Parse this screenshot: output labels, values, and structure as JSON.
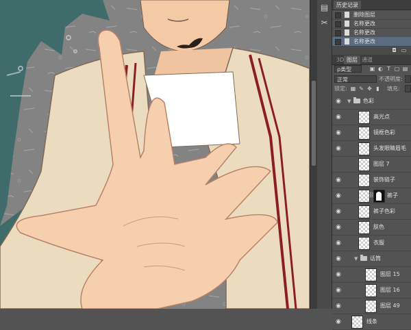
{
  "history_panel": {
    "tab_label": "历史记录",
    "items": [
      {
        "label": "删除图层",
        "selected": false
      },
      {
        "label": "名称更改",
        "selected": false
      },
      {
        "label": "名称更改",
        "selected": false
      },
      {
        "label": "名称更改",
        "selected": true
      }
    ]
  },
  "layers_panel": {
    "tabs": [
      "3D",
      "图层",
      "通道"
    ],
    "active_tab": "图层",
    "filter_kind": "ρ类型",
    "blend_mode": "正常",
    "opacity_label": "不透明度:",
    "lock_label": "锁定:",
    "fill_label": "填充:",
    "layers": [
      {
        "name": "色彩",
        "type": "group",
        "indent": 0,
        "visible": true,
        "expanded": true
      },
      {
        "name": "高光点",
        "type": "layer",
        "indent": 1,
        "visible": true
      },
      {
        "name": "镜框色彩",
        "type": "layer",
        "indent": 1,
        "visible": true
      },
      {
        "name": "头发眼睛眉毛",
        "type": "layer",
        "indent": 1,
        "visible": true
      },
      {
        "name": "图层 7",
        "type": "layer",
        "indent": 1,
        "visible": false
      },
      {
        "name": "装饰链子",
        "type": "layer",
        "indent": 1,
        "visible": true
      },
      {
        "name": "裤子",
        "type": "layer",
        "indent": 1,
        "visible": true,
        "has_mask": true
      },
      {
        "name": "裤子色彩",
        "type": "layer",
        "indent": 1,
        "visible": true
      },
      {
        "name": "肤色",
        "type": "layer",
        "indent": 1,
        "visible": true
      },
      {
        "name": "衣服",
        "type": "layer",
        "indent": 1,
        "visible": true
      },
      {
        "name": "话筒",
        "type": "group",
        "indent": 1,
        "visible": true,
        "expanded": true
      },
      {
        "name": "图层 15",
        "type": "layer",
        "indent": 2,
        "visible": true
      },
      {
        "name": "图层 16",
        "type": "layer",
        "indent": 2,
        "visible": true
      },
      {
        "name": "图层 49",
        "type": "layer",
        "indent": 2,
        "visible": true
      },
      {
        "name": "线条",
        "type": "layer",
        "indent": 0,
        "visible": true
      }
    ]
  },
  "icons": {
    "history_doc": "document-icon",
    "history_tool": "history-brush-icon",
    "eye": "eye-icon",
    "folder": "folder-icon",
    "chain": "link-icon"
  },
  "colors": {
    "panel_bg": "#535353",
    "selected_row": "#5b6b80",
    "canvas_teal": "#3f6b6b",
    "skin": "#f6cfae",
    "jacket": "#ecdcbf",
    "stripe": "#8b1e22"
  }
}
